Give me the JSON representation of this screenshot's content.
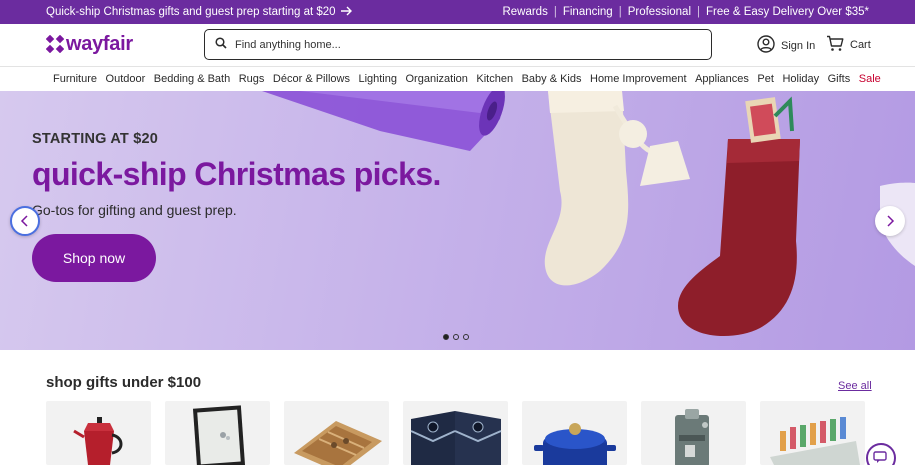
{
  "promo": {
    "left_text": "Quick-ship Christmas gifts and guest prep starting at $20",
    "right_links": [
      "Rewards",
      "Financing",
      "Professional",
      "Free & Easy Delivery Over $35*"
    ]
  },
  "header": {
    "logo_text": "wayfair",
    "search_placeholder": "Find anything home...",
    "signin_label": "Sign In",
    "cart_label": "Cart"
  },
  "categories": [
    "Furniture",
    "Outdoor",
    "Bedding & Bath",
    "Rugs",
    "Décor & Pillows",
    "Lighting",
    "Organization",
    "Kitchen",
    "Baby & Kids",
    "Home Improvement",
    "Appliances",
    "Pet",
    "Holiday",
    "Gifts",
    "Sale"
  ],
  "hero": {
    "subtitle": "STARTING AT $20",
    "title": "quick-ship Christmas picks.",
    "description": "Go-tos for gifting and guest prep.",
    "cta_label": "Shop now",
    "slide_count": 3,
    "active_slide": 1
  },
  "gifts": {
    "title": "shop gifts under $100",
    "see_all_label": "See all",
    "products": [
      "espresso-maker",
      "framed-art",
      "wood-organizer",
      "cornhole-boards",
      "dutch-oven",
      "coffee-machine",
      "drink-dispenser"
    ]
  },
  "colors": {
    "brand": "#7b189f",
    "promo_bar": "#6b2c9f",
    "sale": "#c7002f"
  }
}
